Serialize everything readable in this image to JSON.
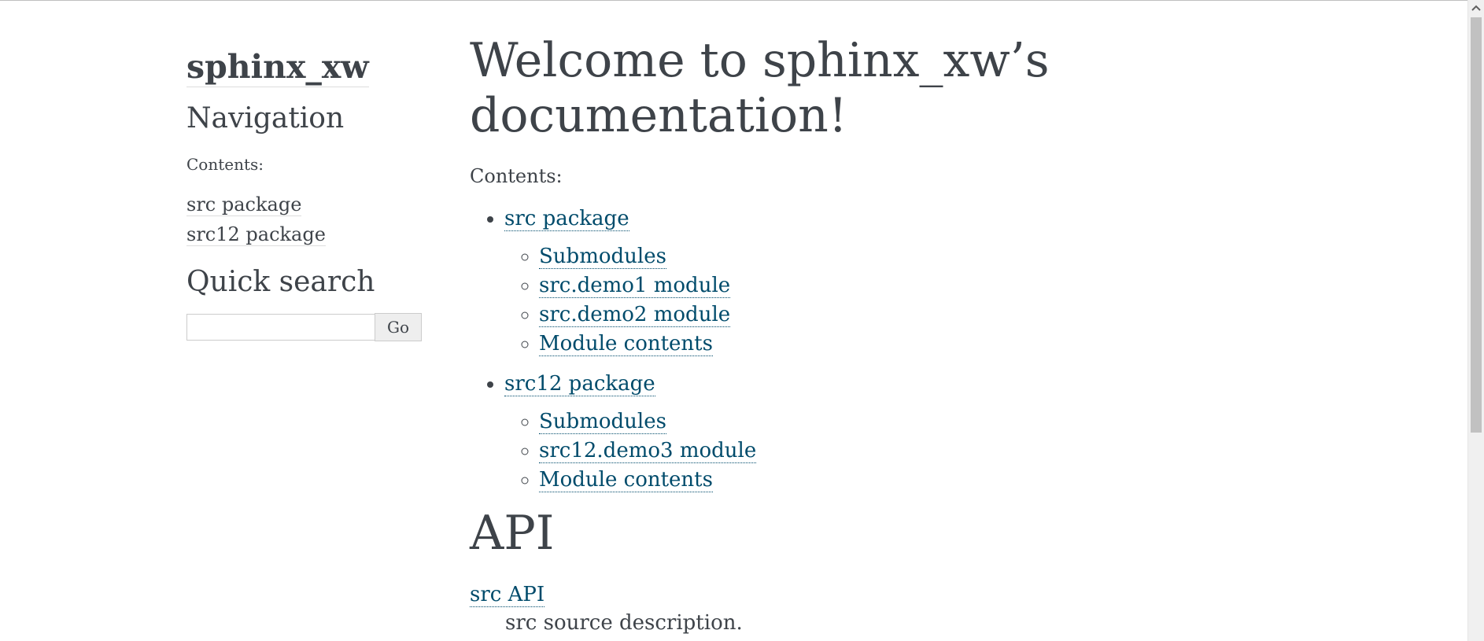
{
  "sidebar": {
    "logo": "sphinx_xw",
    "navigation_title": "Navigation",
    "contents_caption": "Contents:",
    "links": [
      {
        "label": "src package"
      },
      {
        "label": "src12 package"
      }
    ],
    "quick_search_title": "Quick search",
    "search_value": "",
    "search_button": "Go"
  },
  "main": {
    "title": "Welcome to sphinx_xw’s documentation!",
    "contents_caption": "Contents:",
    "toc": [
      {
        "label": "src package",
        "children": [
          "Submodules",
          "src.demo1 module",
          "src.demo2 module",
          "Module contents"
        ]
      },
      {
        "label": "src12 package",
        "children": [
          "Submodules",
          "src12.demo3 module",
          "Module contents"
        ]
      }
    ],
    "api_title": "API",
    "api_link": "src API",
    "api_description": "src source description."
  },
  "colors": {
    "text": "#3e4349",
    "link": "#004b6b"
  },
  "icons": {
    "scroll_up": "chevron-up-icon"
  }
}
